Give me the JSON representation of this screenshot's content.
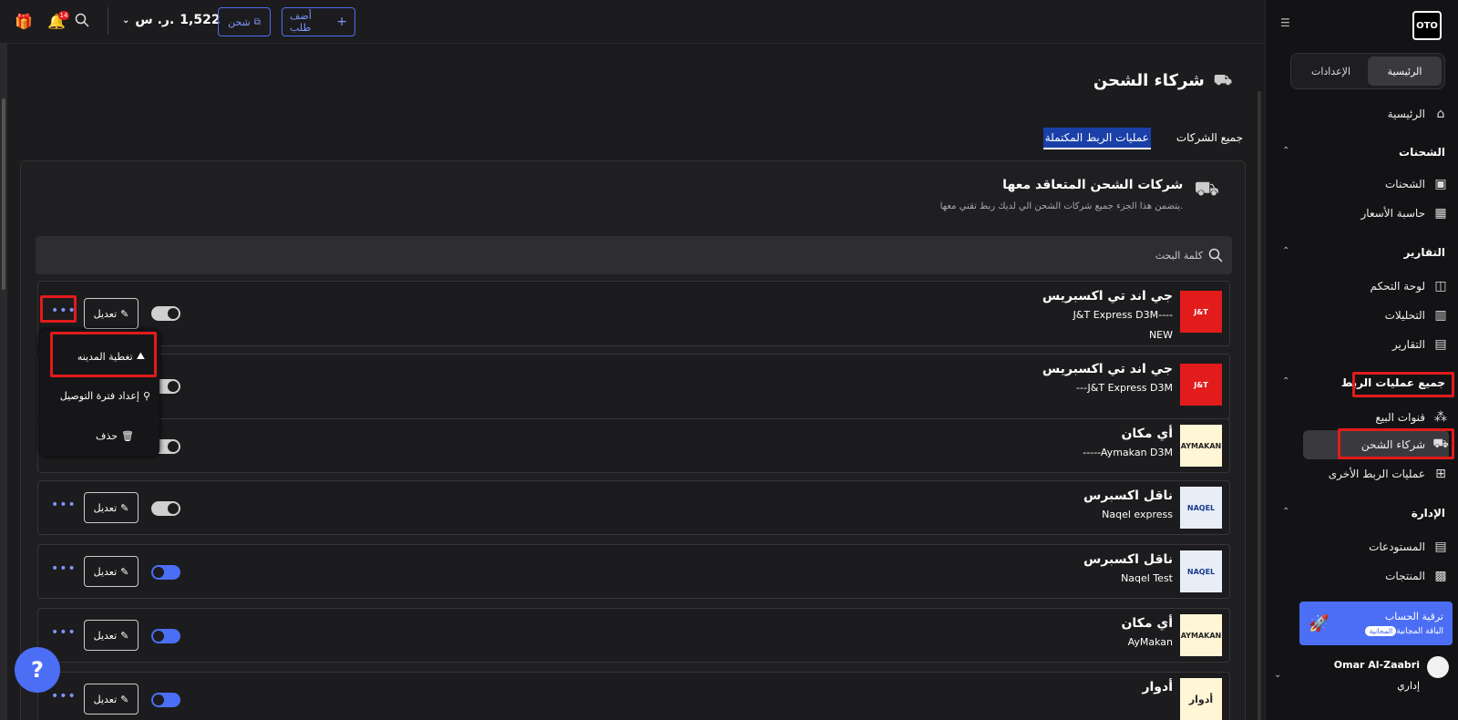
{
  "sidebar": {
    "logo": "OTO",
    "seg_home": "الرئيسية",
    "seg_settings": "الإعدادات",
    "home": "الرئيسية",
    "sec_shipments": "الشحنات",
    "shipments": "الشحنات",
    "price_calc": "حاسبة الأسعار",
    "sec_reports": "التقارير",
    "dashboard": "لوحة التحكم",
    "analytics": "التحليلات",
    "reports": "التقارير",
    "sec_integrations": "جميع عمليات الربط",
    "sales_channels": "قنوات البيع",
    "shipping_partners": "شركاء الشحن",
    "other_integrations": "عمليات الربط الأخرى",
    "sec_management": "الإدارة",
    "warehouses": "المستودعات",
    "products": "المنتجات",
    "upgrade_title": "ترقية الحساب",
    "upgrade_plan": "الباقة المجانية",
    "upgrade_pill": "المجانية",
    "user_name": "Omar Al-Zaabri",
    "user_role": "إداري"
  },
  "topbar": {
    "notif_count": "14",
    "balance_amount": "1,522",
    "balance_currency": "ر. س.",
    "ship_label": "شحن",
    "add_order_label": "أضف طلب"
  },
  "page": {
    "title": "شركاء الشحن",
    "tab_all": "جميع الشركات",
    "tab_completed": "عمليات الربط المكتملة",
    "panel_title": "شركات الشحن المتعاقد معها",
    "panel_subtitle": "يتضمن هذا الجزء جميع شركات الشحن الي لديك ربط تقني معها.",
    "search_placeholder": "كلمة البحث",
    "edit_label": "تعديل",
    "more_label": "•••"
  },
  "cards": [
    {
      "name": "جي اند تي اكسبريس",
      "sub": "J&T Express D3M----",
      "sub2": "NEW",
      "logo": "J&T",
      "active": false
    },
    {
      "name": "جي اند تي اكسبريس",
      "sub": "---J&T Express D3M",
      "sub2": "",
      "logo": "J&T",
      "active": false
    },
    {
      "name": "أي مكان",
      "sub": "-----Aymakan D3M",
      "sub2": "",
      "logo": "AYMAKAN",
      "active": false
    },
    {
      "name": "ناقل اكسبرس",
      "sub": "Naqel express",
      "sub2": "",
      "logo": "NAQEL",
      "active": false
    },
    {
      "name": "ناقل اكسبرس",
      "sub": "Naqel Test",
      "sub2": "",
      "logo": "NAQEL",
      "active": true
    },
    {
      "name": "أي مكان",
      "sub": "AyMakan",
      "sub2": "",
      "logo": "AYMAKAN",
      "active": true
    },
    {
      "name": "أدوار",
      "sub": "",
      "sub2": "",
      "logo": "أدوار",
      "active": true
    }
  ],
  "menu": {
    "city_coverage": "تغطية المدينه",
    "delivery_window": "إعداد فترة التوصيل",
    "delete": "حذف"
  },
  "help_label": "?",
  "colors": {
    "accent": "#4c6ef5",
    "highlight": "#e21b1b",
    "jt_red": "#e21b1b",
    "aymakan_bg": "#fff6d6"
  }
}
